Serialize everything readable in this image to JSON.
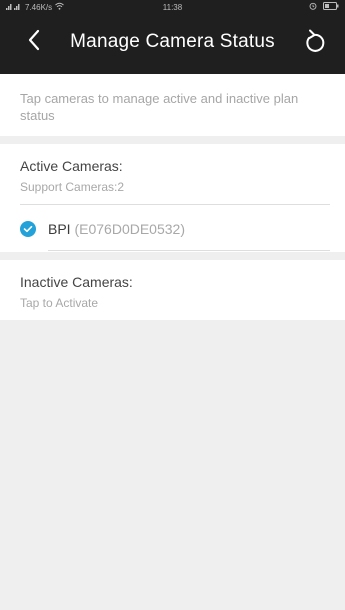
{
  "status_bar": {
    "left_text": "7.46K/s",
    "time": "11:38"
  },
  "header": {
    "title": "Manage Camera Status",
    "back_icon": "chevron-left-icon",
    "refresh_icon": "refresh-icon"
  },
  "hint": {
    "text": "Tap cameras to manage active and inactive plan status"
  },
  "active_section": {
    "title": "Active Cameras:",
    "subtitle": "Support Cameras:2",
    "cameras": [
      {
        "name": "BPI",
        "id": "(E076D0DE0532)",
        "checked": true
      }
    ]
  },
  "inactive_section": {
    "title": "Inactive Cameras:",
    "subtitle": "Tap to Activate"
  },
  "colors": {
    "header_bg": "#1f1f1f",
    "accent": "#23a1d9",
    "page_bg": "#efefef"
  }
}
